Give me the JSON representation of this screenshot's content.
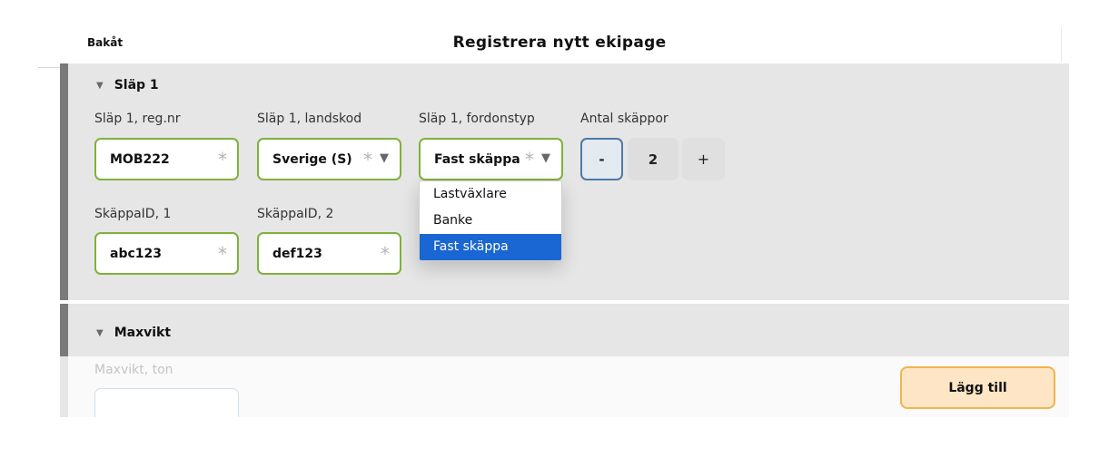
{
  "header": {
    "back_label": "Bakåt",
    "title": "Registrera nytt ekipage"
  },
  "trailer_section": {
    "title": "Släp 1",
    "collapse_icon": "triangle-down-icon",
    "fields": {
      "reg_nr": {
        "label": "Släp 1, reg.nr",
        "value": "MOB222"
      },
      "country_code": {
        "label": "Släp 1, landskod",
        "value": "Sverige (S)"
      },
      "vehicle_type": {
        "label": "Släp 1, fordonstyp",
        "value": "Fast skäppa"
      },
      "container_count": {
        "label": "Antal skäppor",
        "value": "2",
        "minus_label": "-",
        "plus_label": "+"
      },
      "container_id_1": {
        "label": "SkäppaID, 1",
        "value": "abc123"
      },
      "container_id_2": {
        "label": "SkäppaID, 2",
        "value": "def123"
      }
    },
    "required_marker": "*",
    "vehicle_type_options": [
      "Lastväxlare",
      "Banke",
      "Fast skäppa"
    ],
    "vehicle_type_selected": "Fast skäppa"
  },
  "maxweight_section": {
    "title": "Maxvikt",
    "collapse_icon": "triangle-down-icon",
    "field_label": "Maxvikt, ton",
    "field_value": ""
  },
  "actions": {
    "add_label": "Lägg till"
  },
  "colors": {
    "field_border": "#7fb23b",
    "selected_option": "#1a66d2",
    "add_button_bg": "#fde5c5",
    "add_button_border": "#f0b44d",
    "section_bg": "#e6e6e6"
  }
}
